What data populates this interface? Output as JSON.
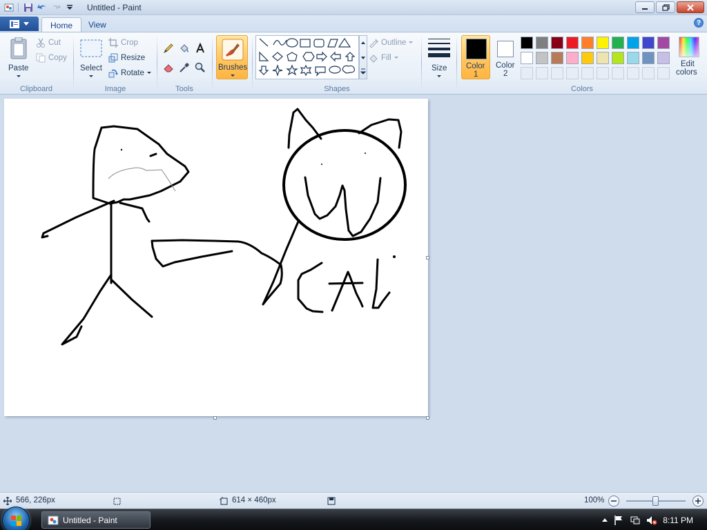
{
  "window": {
    "title": "Untitled - Paint"
  },
  "quick_access": {
    "icons": [
      "save-icon",
      "undo-icon",
      "redo-icon",
      "customize-icon"
    ]
  },
  "tabs": [
    {
      "label": "Home"
    },
    {
      "label": "View"
    }
  ],
  "ribbon": {
    "clipboard": {
      "paste": "Paste",
      "cut": "Cut",
      "copy": "Copy",
      "group": "Clipboard"
    },
    "image": {
      "select": "Select",
      "crop": "Crop",
      "resize": "Resize",
      "rotate": "Rotate",
      "group": "Image"
    },
    "tools": {
      "group": "Tools"
    },
    "brushes": {
      "label": "Brushes"
    },
    "shapes": {
      "outline": "Outline",
      "fill": "Fill",
      "group": "Shapes"
    },
    "size": {
      "label": "Size"
    },
    "color1": {
      "label_line1": "Color",
      "label_line2": "1",
      "value": "#000000"
    },
    "color2": {
      "label_line1": "Color",
      "label_line2": "2",
      "value": "#ffffff"
    },
    "colors": {
      "group": "Colors",
      "palette_row1": [
        "#000000",
        "#7f7f7f",
        "#880015",
        "#ed1c24",
        "#ff7f27",
        "#fff200",
        "#22b14c",
        "#00a2e8",
        "#3f48cc",
        "#a349a4"
      ],
      "palette_row2": [
        "#ffffff",
        "#c3c3c3",
        "#b97a57",
        "#ffaec9",
        "#ffc90e",
        "#efe4b0",
        "#b5e61d",
        "#99d9ea",
        "#7092be",
        "#c8bfe7"
      ],
      "edit_line1": "Edit",
      "edit_line2": "colors"
    }
  },
  "canvas": {
    "drawing_text": "CAt"
  },
  "status": {
    "cursor_pos": "566, 226px",
    "canvas_size": "614 × 460px",
    "zoom": "100%",
    "zoom_level": 0.5
  },
  "taskbar": {
    "item": "Untitled - Paint",
    "time": "8:11 PM"
  }
}
